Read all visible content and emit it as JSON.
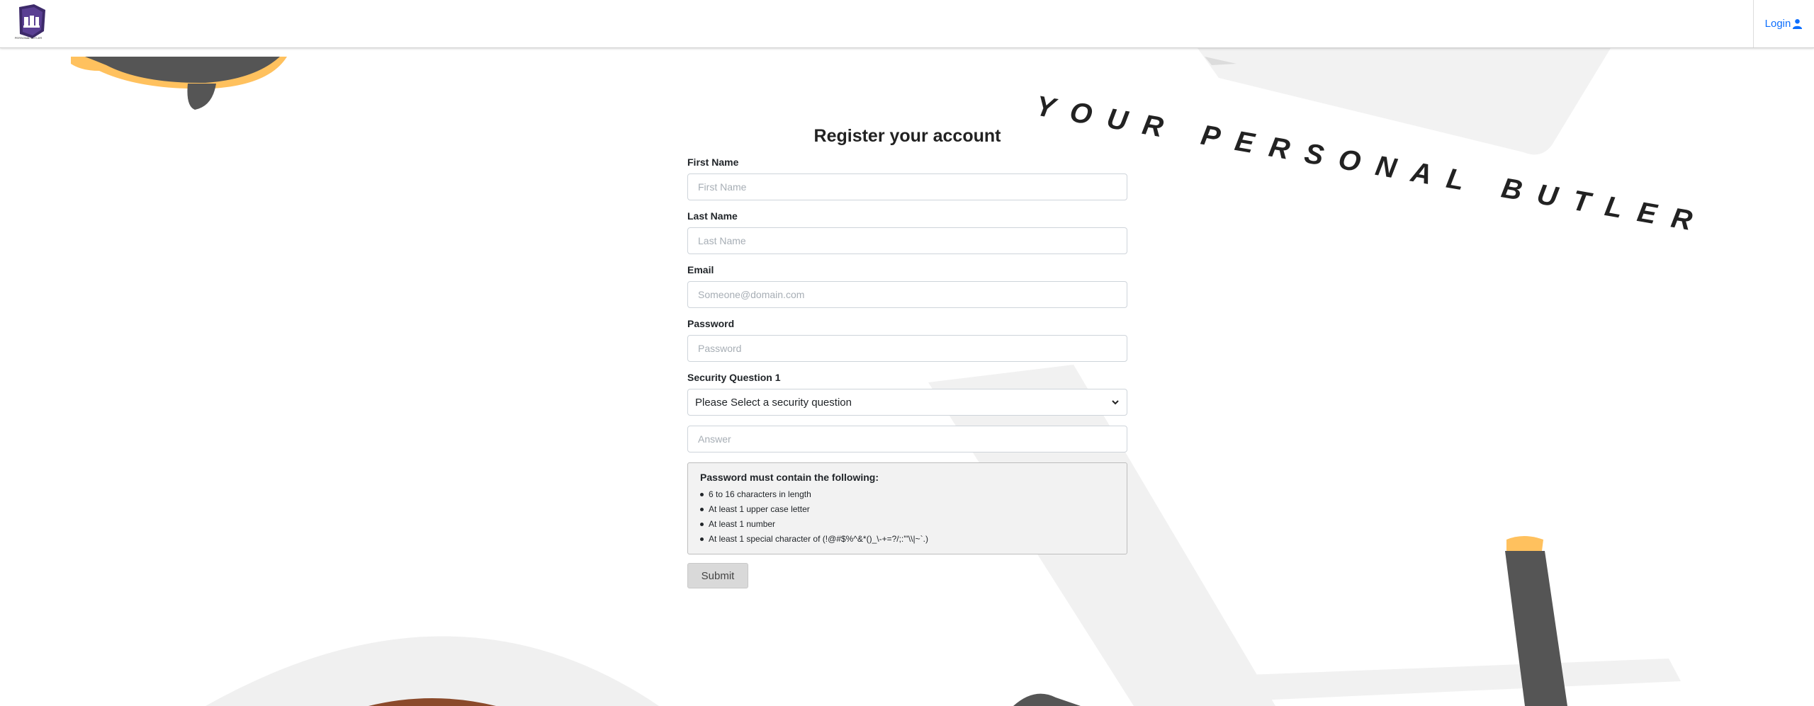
{
  "brand": {
    "logo_text": "PERSONAL BUTLER"
  },
  "nav": {
    "login_label": "Login"
  },
  "background": {
    "tagline": "YOUR PERSONAL BUTLER"
  },
  "form": {
    "title": "Register your account",
    "first_name": {
      "label": "First Name",
      "placeholder": "First Name"
    },
    "last_name": {
      "label": "Last Name",
      "placeholder": "Last Name"
    },
    "email": {
      "label": "Email",
      "placeholder": "Someone@domain.com"
    },
    "password": {
      "label": "Password",
      "placeholder": "Password"
    },
    "security_question": {
      "label": "Security Question 1",
      "selected": "Please Select a security question"
    },
    "answer": {
      "placeholder": "Answer"
    },
    "rules": {
      "title": "Password must contain the following:",
      "items": [
        "6 to 16 characters in length",
        "At least 1 upper case letter",
        "At least 1 number",
        "At least 1 special character of (!@#$%^&*()_\\-+=?/;:'\"\\\\|~`.)"
      ]
    },
    "submit_label": "Submit"
  },
  "colors": {
    "link": "#0d6efd",
    "accent_yellow": "#ffc15e",
    "dark_gray": "#555555",
    "light_gray": "#f0f0f0"
  }
}
